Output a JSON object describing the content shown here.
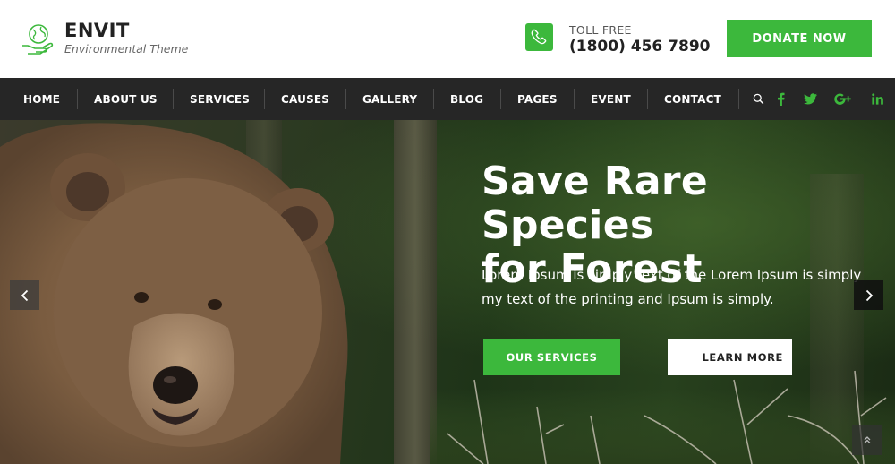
{
  "brand": {
    "name": "ENVIT",
    "tagline": "Environmental Theme",
    "icon": "globe-in-hand-icon"
  },
  "contact": {
    "label": "TOLL FREE",
    "number": "(1800) 456 7890",
    "icon": "phone-icon"
  },
  "donate_label": "DONATE NOW",
  "nav": {
    "items": [
      "HOME",
      "ABOUT US",
      "SERVICES",
      "CAUSES",
      "GALLERY",
      "BLOG",
      "PAGES",
      "EVENT",
      "CONTACT"
    ],
    "icons": [
      "search-icon",
      "facebook-icon",
      "twitter-icon",
      "google-plus-icon",
      "linkedin-icon"
    ]
  },
  "hero": {
    "title_line1": "Save Rare Species",
    "title_line2": "for Forest",
    "text": "Lorem Ipsum is simply text of the Lorem Ipsum is simply my text of the printing and Ipsum is simply.",
    "primary_button": "OUR SERVICES",
    "secondary_button": "LEARN MORE"
  },
  "colors": {
    "accent": "#3cb83c",
    "navbar": "#262626",
    "text_dark": "#222222"
  }
}
